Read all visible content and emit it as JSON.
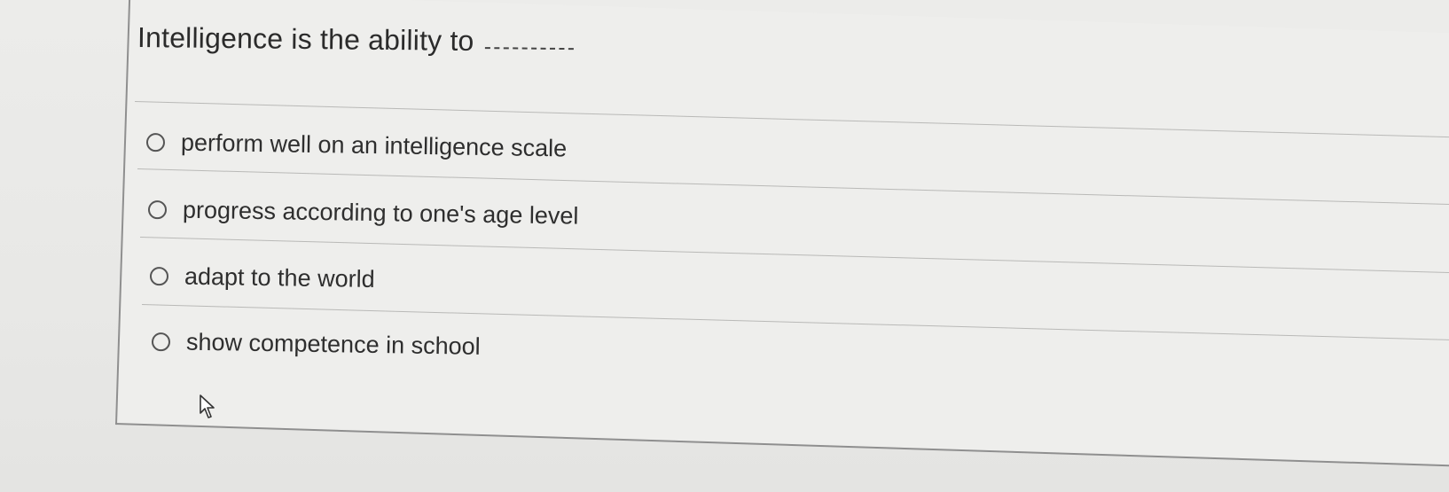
{
  "question": {
    "text": "Intelligence is the ability to"
  },
  "options": [
    {
      "label": "perform well on an intelligence scale"
    },
    {
      "label": "progress according to one's age level"
    },
    {
      "label": "adapt to the world"
    },
    {
      "label": "show competence in school"
    }
  ],
  "icons": {
    "radio": "radio-unselected-icon",
    "cursor": "mouse-pointer-icon"
  },
  "colors": {
    "background": "#eeeeec",
    "text": "#2e2e2e",
    "border": "#8f8f8f"
  }
}
